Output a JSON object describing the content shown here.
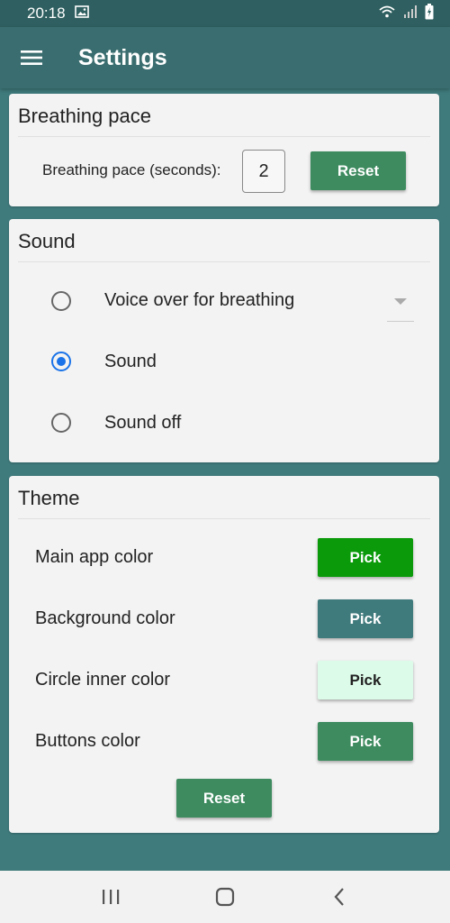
{
  "status_bar": {
    "time": "20:18"
  },
  "app_bar": {
    "title": "Settings"
  },
  "breathing_pace": {
    "title": "Breathing pace",
    "label": "Breathing pace (seconds):",
    "value": "2",
    "reset_label": "Reset"
  },
  "sound": {
    "title": "Sound",
    "options": [
      {
        "label": "Voice over for breathing",
        "selected": false
      },
      {
        "label": "Sound",
        "selected": true
      },
      {
        "label": "Sound off",
        "selected": false
      }
    ]
  },
  "theme": {
    "title": "Theme",
    "items": [
      {
        "label": "Main app color",
        "pick_label": "Pick",
        "color": "#0a9a0a",
        "text_color": "#ffffff"
      },
      {
        "label": "Background color",
        "pick_label": "Pick",
        "color": "#3f7a7c",
        "text_color": "#ffffff"
      },
      {
        "label": "Circle inner color",
        "pick_label": "Pick",
        "color": "#dcfbe8",
        "text_color": "#222222"
      },
      {
        "label": "Buttons color",
        "pick_label": "Pick",
        "color": "#3d8b5f",
        "text_color": "#ffffff"
      }
    ],
    "reset_label": "Reset"
  },
  "colors": {
    "accent": "#1a73e8",
    "button": "#3d8b5f",
    "app_bar": "#3a6d6f",
    "background": "#3f7a7c"
  },
  "nav": {
    "recent_icon": "recent-apps-icon",
    "home_icon": "home-icon",
    "back_icon": "back-icon"
  }
}
